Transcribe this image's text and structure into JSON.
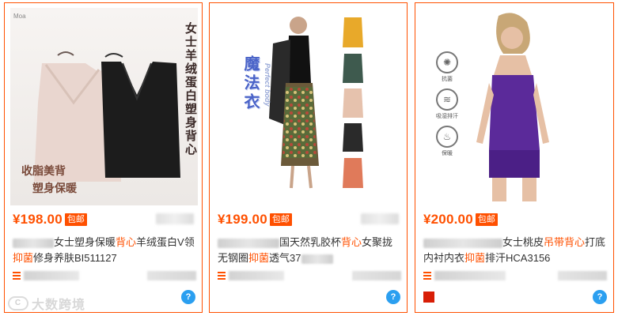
{
  "products": [
    {
      "price": "¥198.00",
      "badge": "包邮",
      "title_prefix_blurred": true,
      "title_parts": [
        {
          "text": "女士塑身保暖",
          "hl": false
        },
        {
          "text": "背心",
          "hl": true
        },
        {
          "text": "羊绒蛋白V领",
          "hl": false
        },
        {
          "text": "抑菌",
          "hl": true
        },
        {
          "text": "修身养肤BI511127",
          "hl": false
        }
      ],
      "image_vertical_text": "女士羊绒蛋白塑身背心",
      "image_promo_1": "收脂美背",
      "image_promo_2": "塑身保暖"
    },
    {
      "price": "¥199.00",
      "badge": "包邮",
      "title_parts": [
        {
          "text": "国天然乳胶杯",
          "hl": false
        },
        {
          "text": "背心",
          "hl": true
        },
        {
          "text": "女聚拢无钢圈",
          "hl": false
        },
        {
          "text": "抑菌",
          "hl": true
        },
        {
          "text": "透气37",
          "hl": false
        }
      ],
      "image_vertical_text": "魔法衣",
      "image_vertical_en": "Perfect body"
    },
    {
      "price": "¥200.00",
      "badge": "包邮",
      "title_parts": [
        {
          "text": "女士桃皮",
          "hl": false
        },
        {
          "text": "吊带背心",
          "hl": true
        },
        {
          "text": "打底内衬内衣",
          "hl": false
        },
        {
          "text": "抑菌",
          "hl": true
        },
        {
          "text": "排汗HCA3156",
          "hl": false
        }
      ],
      "features": [
        "抗菌",
        "吸湿排汗",
        "保暖"
      ]
    }
  ],
  "watermark": "大数跨境",
  "colors": {
    "accent": "#ff5000",
    "ww_blue": "#2b9ff0"
  }
}
